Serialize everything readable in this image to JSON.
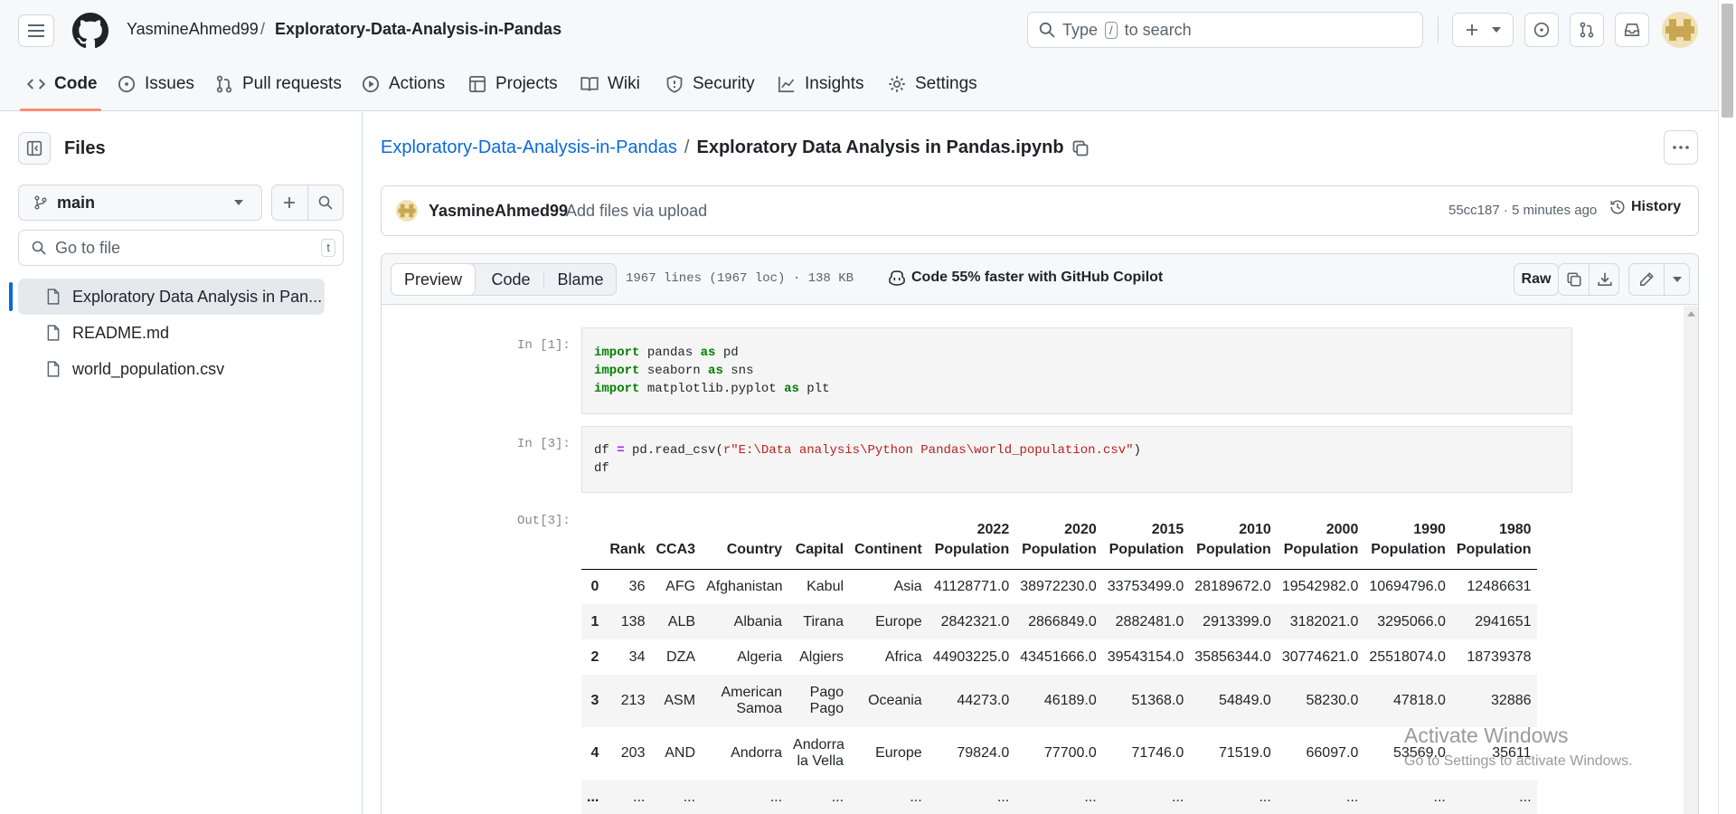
{
  "header": {
    "owner": "YasmineAhmed99",
    "separator": "/",
    "repo": "Exploratory-Data-Analysis-in-Pandas",
    "search_pre": "Type",
    "search_key": "/",
    "search_post": "to search"
  },
  "tabs": [
    {
      "label": "Code",
      "icon": "code-icon",
      "active": true
    },
    {
      "label": "Issues",
      "icon": "issue-icon"
    },
    {
      "label": "Pull requests",
      "icon": "pull-request-icon"
    },
    {
      "label": "Actions",
      "icon": "play-icon"
    },
    {
      "label": "Projects",
      "icon": "table-icon"
    },
    {
      "label": "Wiki",
      "icon": "book-icon"
    },
    {
      "label": "Security",
      "icon": "shield-icon"
    },
    {
      "label": "Insights",
      "icon": "graph-icon"
    },
    {
      "label": "Settings",
      "icon": "gear-icon"
    }
  ],
  "sidebar": {
    "title": "Files",
    "branch": "main",
    "goto_placeholder": "Go to file",
    "goto_shortcut": "t",
    "files": [
      {
        "name": "Exploratory Data Analysis in Pan...",
        "selected": true
      },
      {
        "name": "README.md"
      },
      {
        "name": "world_population.csv"
      }
    ]
  },
  "breadcrumb": {
    "repo": "Exploratory-Data-Analysis-in-Pandas",
    "sep": "/",
    "file": "Exploratory Data Analysis in Pandas.ipynb"
  },
  "commit": {
    "author": "YasmineAhmed99",
    "message": "Add files via upload",
    "meta": "55cc187 · 5 minutes ago",
    "history": "History"
  },
  "toolbar": {
    "view_tabs": [
      "Preview",
      "Code",
      "Blame"
    ],
    "active_view": "Preview",
    "stats": "1967 lines (1967 loc) · 138 KB",
    "copilot": "Code 55% faster with GitHub Copilot",
    "raw": "Raw"
  },
  "notebook": {
    "cell1_prompt": "In [1]:",
    "cell1_lines": [
      [
        "import",
        " pandas ",
        "as",
        " pd"
      ],
      [
        "import",
        " seaborn ",
        "as",
        " sns"
      ],
      [
        "import",
        " matplotlib.pyplot ",
        "as",
        " plt"
      ]
    ],
    "cell2_prompt": "In [3]:",
    "cell2_line1": {
      "a": "df ",
      "eq": "=",
      "b": " pd.read_csv(",
      "s": "r\"E:\\Data analysis\\Python Pandas\\world_population.csv\"",
      "c": ")"
    },
    "cell2_line2": "df",
    "out_prompt": "Out[3]:",
    "columns": [
      "",
      "Rank",
      "CCA3",
      "Country",
      "Capital",
      "Continent",
      "2022 Population",
      "2020 Population",
      "2015 Population",
      "2010 Population",
      "2000 Population",
      "1990 Population",
      "1980 Population"
    ],
    "rows": [
      [
        "0",
        "36",
        "AFG",
        "Afghanistan",
        "Kabul",
        "Asia",
        "41128771.0",
        "38972230.0",
        "33753499.0",
        "28189672.0",
        "19542982.0",
        "10694796.0",
        "12486631"
      ],
      [
        "1",
        "138",
        "ALB",
        "Albania",
        "Tirana",
        "Europe",
        "2842321.0",
        "2866849.0",
        "2882481.0",
        "2913399.0",
        "3182021.0",
        "3295066.0",
        "2941651"
      ],
      [
        "2",
        "34",
        "DZA",
        "Algeria",
        "Algiers",
        "Africa",
        "44903225.0",
        "43451666.0",
        "39543154.0",
        "35856344.0",
        "30774621.0",
        "25518074.0",
        "18739378"
      ],
      [
        "3",
        "213",
        "ASM",
        "American Samoa",
        "Pago Pago",
        "Oceania",
        "44273.0",
        "46189.0",
        "51368.0",
        "54849.0",
        "58230.0",
        "47818.0",
        "32886"
      ],
      [
        "4",
        "203",
        "AND",
        "Andorra",
        "Andorra la Vella",
        "Europe",
        "79824.0",
        "77700.0",
        "71746.0",
        "71519.0",
        "66097.0",
        "53569.0",
        "35611"
      ],
      [
        "...",
        "...",
        "...",
        "...",
        "...",
        "...",
        "...",
        "...",
        "...",
        "...",
        "...",
        "...",
        "..."
      ]
    ]
  },
  "watermark": {
    "title": "Activate Windows",
    "subtitle": "Go to Settings to activate Windows."
  },
  "colors": {
    "accent_tab": "#fd8c73",
    "link": "#0969da",
    "kw": "#008000",
    "string": "#ba2121"
  }
}
